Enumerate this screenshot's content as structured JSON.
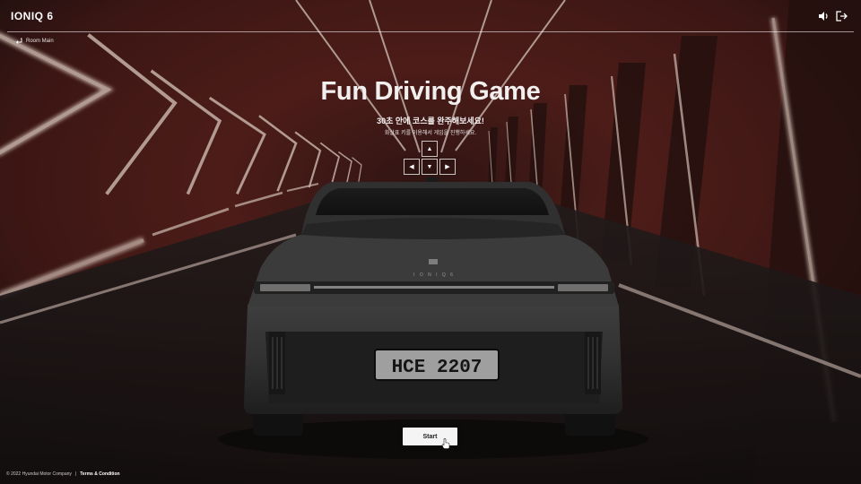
{
  "header": {
    "logo": "IONIQ 6",
    "sound_icon": "speaker-icon",
    "exit_icon": "logout-icon"
  },
  "nav": {
    "room_main_label": "Room Main",
    "room_main_icon": "return-arrow-icon"
  },
  "main": {
    "title": "Fun Driving Game",
    "subtitle": "30초 안에 코스를 완주해보세요!",
    "instruction": "화살표 키를 이용해서 게임을 진행하세요.",
    "keys": {
      "up": "▲",
      "left": "◀",
      "down": "▼",
      "right": "▶"
    },
    "start_label": "Start"
  },
  "car": {
    "plate": "HCE 2207",
    "badge": "I O N I Q 6"
  },
  "footer": {
    "copyright": "© 2022 Hyundai Motor Company",
    "separator": "|",
    "terms": "Terms & Condition"
  },
  "colors": {
    "tunnel_red": "#7a2a26",
    "tunnel_dark": "#2a1816",
    "neon": "#f2d9cc",
    "car_body": "#3e3d3d",
    "button_bg": "#f4f4f4"
  }
}
